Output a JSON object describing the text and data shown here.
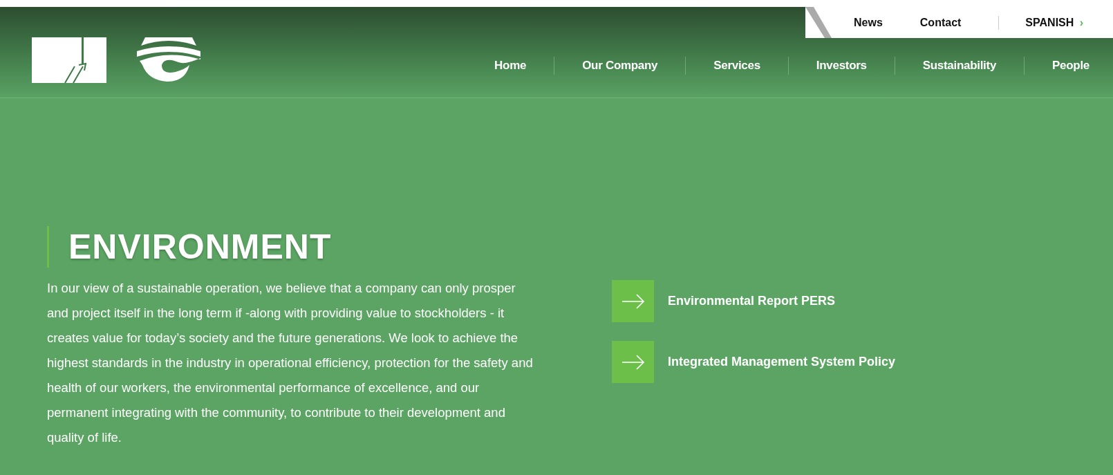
{
  "top_links": [
    {
      "label": "News"
    },
    {
      "label": "Contact"
    }
  ],
  "language": {
    "label": "SPANISH",
    "arrow": "›"
  },
  "nav": [
    {
      "label": "Home"
    },
    {
      "label": "Our Company"
    },
    {
      "label": "Services"
    },
    {
      "label": "Investors"
    },
    {
      "label": "Sustainability"
    },
    {
      "label": "People"
    }
  ],
  "heading": "ENVIRONMENT",
  "body": "In our view of a sustainable operation, we believe that a company can only prosper and project itself in the long term if -along with providing value to stockholders - it creates value for today’s society and the future generations. We look to achieve the highest standards in the industry in operational efficiency, protection for the safety and health of our workers, the environmental performance of excellence, and our permanent integrating with the community, to contribute to their development and quality of life.",
  "documents": [
    {
      "label": "Environmental Report PERS"
    },
    {
      "label": "Integrated Management System Policy"
    }
  ]
}
